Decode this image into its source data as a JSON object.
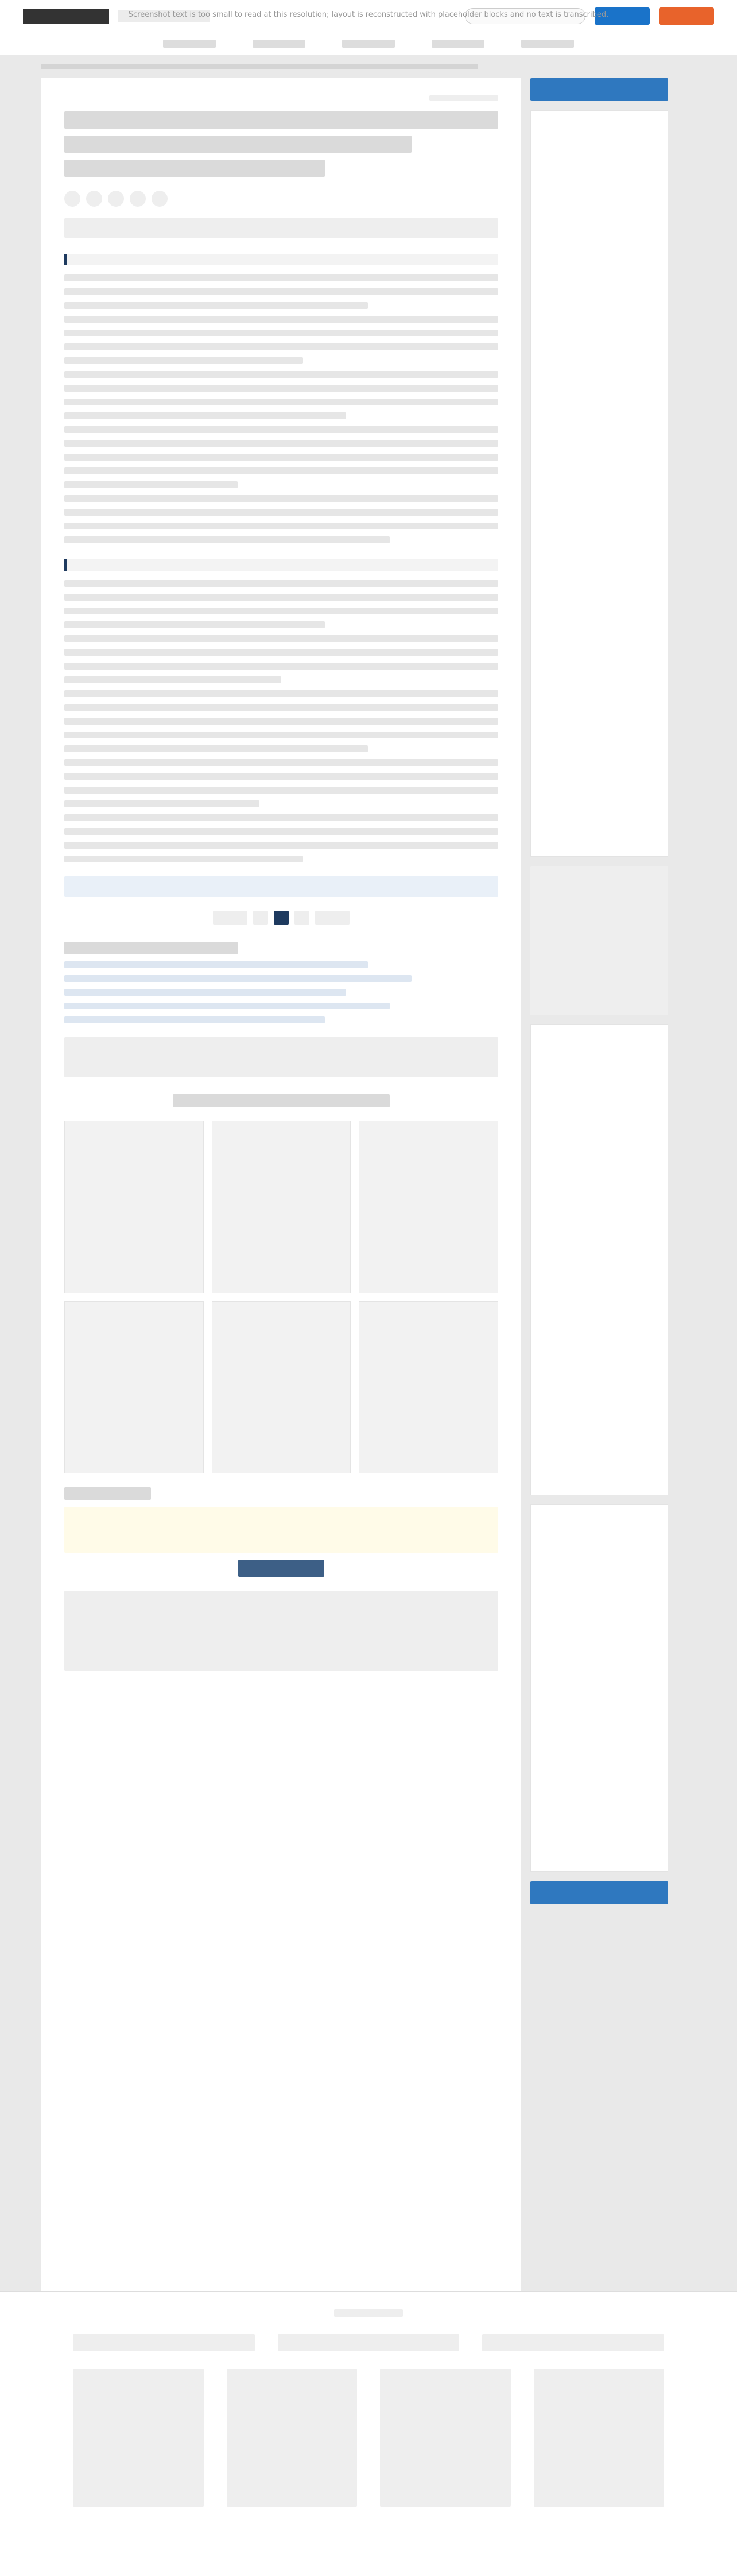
{
  "notice": "Screenshot text is too small to read at this resolution; layout is reconstructed with placeholder blocks and no text is transcribed."
}
